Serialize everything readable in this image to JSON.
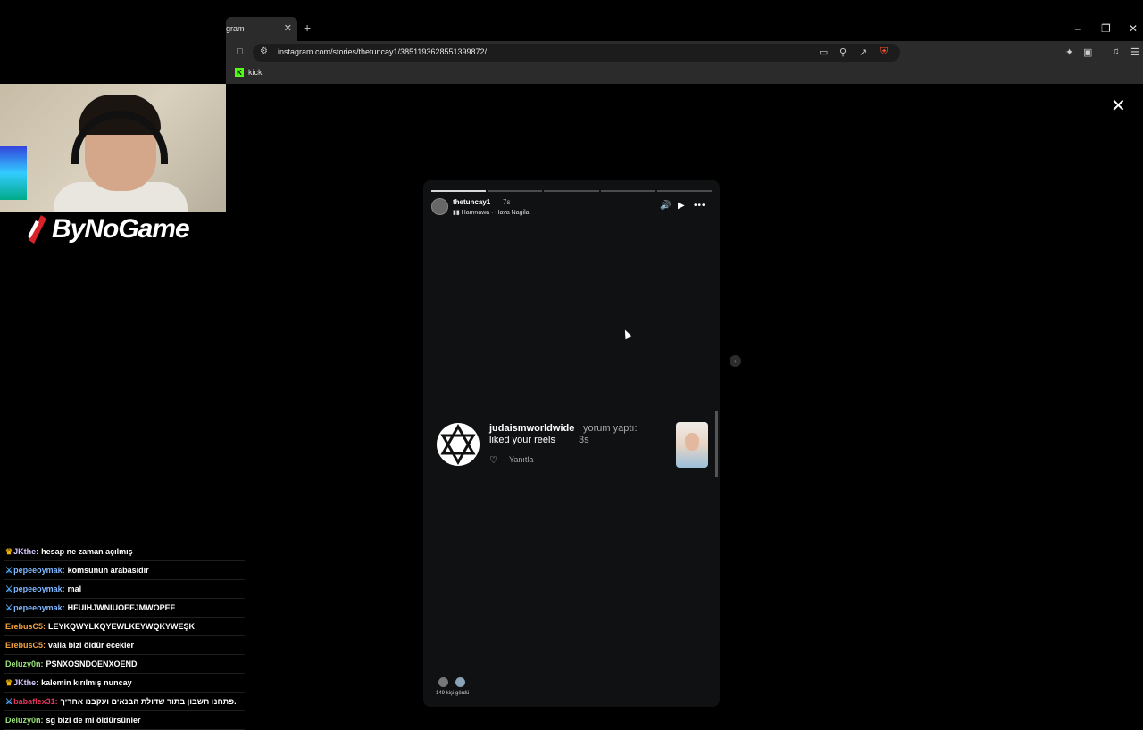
{
  "browser": {
    "tab_title": "gram",
    "tab_close": "✕",
    "new_tab": "+",
    "url": "instagram.com/stories/thetuncay1/3851193628551399872/",
    "bookmark": "kick",
    "window_controls": [
      "–",
      "❐",
      "✕"
    ]
  },
  "overlay": {
    "logo_text": "ByNoGame"
  },
  "chat": [
    {
      "badge": "crown",
      "user": "JKthe:",
      "user_color": "#d6c7ff",
      "text": "hesap ne zaman açılmış"
    },
    {
      "badge": "sword",
      "user": "pepeeoymak:",
      "user_color": "#7fb7ff",
      "text": "komsunun arabasıdır"
    },
    {
      "badge": "sword",
      "user": "pepeeoymak:",
      "user_color": "#7fb7ff",
      "text": "mal"
    },
    {
      "badge": "sword",
      "user": "pepeeoymak:",
      "user_color": "#7fb7ff",
      "text": "HFUIHJWNIUOEFJMWOPEF"
    },
    {
      "badge": "",
      "user": "ErebusC5:",
      "user_color": "#f4a340",
      "text": "LEYKQWYLKQYEWLKEYWQKYWEŞK"
    },
    {
      "badge": "",
      "user": "ErebusC5:",
      "user_color": "#f4a340",
      "text": "valla bizi öldür ecekler"
    },
    {
      "badge": "",
      "user": "Deluzy0n:",
      "user_color": "#9be37a",
      "text": "PSNXOSNDOENXOEND"
    },
    {
      "badge": "crown",
      "user": "JKthe:",
      "user_color": "#d6c7ff",
      "text": "kalemin kırılmış nuncay"
    },
    {
      "badge": "sword",
      "user": "babaflex31:",
      "user_color": "#e0365c",
      "text": "פתחנו חשבון בתור שדולת הבנאים ועקבנו אחריך."
    },
    {
      "badge": "",
      "user": "Deluzy0n:",
      "user_color": "#9be37a",
      "text": "sg bizi de mi öldürsünler"
    }
  ],
  "story": {
    "username": "thetuncay1",
    "time": "7s",
    "music": "Hamnawa · Hava Nagila",
    "progress": [
      1,
      0,
      0,
      0,
      0
    ],
    "notification": {
      "user": "judaismworldwide",
      "action": "yorum yaptı:",
      "text": "liked your reels",
      "time": "3s",
      "reply": "Yanıtla"
    },
    "seen": "149 kişi gördü"
  }
}
